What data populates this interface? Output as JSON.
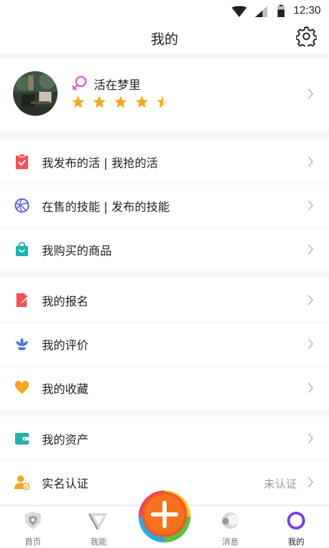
{
  "status": {
    "time": "12:30"
  },
  "header": {
    "title": "我的",
    "settings_icon": "gear-icon"
  },
  "profile": {
    "name": "活在梦里",
    "gender_icon": "female-icon",
    "rating": 4.5,
    "rating_max": 5
  },
  "menu_groups": [
    [
      {
        "label": "我发布的活 | 我抢的活",
        "icon": "clipboard-check-icon",
        "color": "#ef5358"
      },
      {
        "label": "在售的技能 | 发布的技能",
        "icon": "volleyball-icon",
        "color": "#5b5fd6"
      },
      {
        "label": "我购买的商品",
        "icon": "shopping-bag-icon",
        "color": "#21b3a5"
      }
    ],
    [
      {
        "label": "我的报名",
        "icon": "edit-document-icon",
        "color": "#ef5358"
      },
      {
        "label": "我的评价",
        "icon": "lotus-icon",
        "color": "#4a78e0"
      },
      {
        "label": "我的收藏",
        "icon": "heart-icon",
        "color": "#f5a623"
      }
    ],
    [
      {
        "label": "我的资产",
        "icon": "wallet-icon",
        "color": "#21b3a5"
      },
      {
        "label": "实名认证",
        "icon": "user-verified-icon",
        "color": "#f5a623",
        "value": "未认证"
      }
    ]
  ],
  "tabbar": {
    "items": [
      {
        "label": "首页",
        "icon": "home-icon"
      },
      {
        "label": "我能",
        "icon": "skill-icon"
      },
      {
        "label": "",
        "icon": "add-icon"
      },
      {
        "label": "消息",
        "icon": "message-icon"
      },
      {
        "label": "我的",
        "icon": "profile-ring-icon"
      }
    ],
    "active": "我的",
    "accent": "#7a3fe0"
  }
}
